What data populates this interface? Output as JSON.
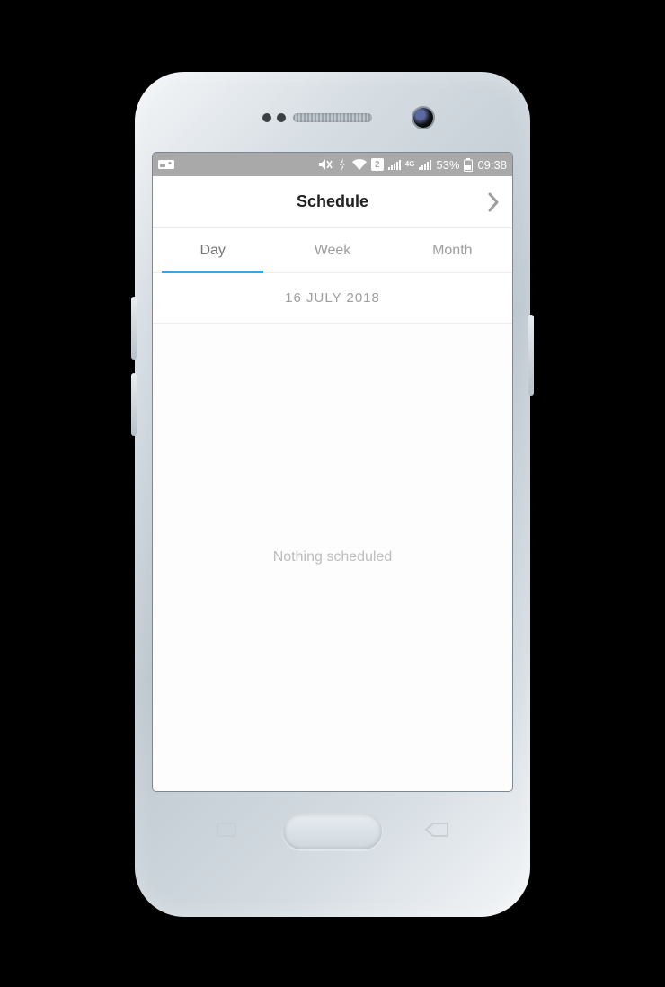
{
  "status_bar": {
    "battery_text": "53%",
    "time_text": "09:38",
    "sim_label": "2",
    "net_label": "4G"
  },
  "header": {
    "title": "Schedule"
  },
  "tabs": {
    "items": [
      {
        "label": "Day",
        "active": true
      },
      {
        "label": "Week",
        "active": false
      },
      {
        "label": "Month",
        "active": false
      }
    ]
  },
  "date": {
    "label": "16 JULY 2018"
  },
  "content": {
    "empty_message": "Nothing scheduled"
  }
}
